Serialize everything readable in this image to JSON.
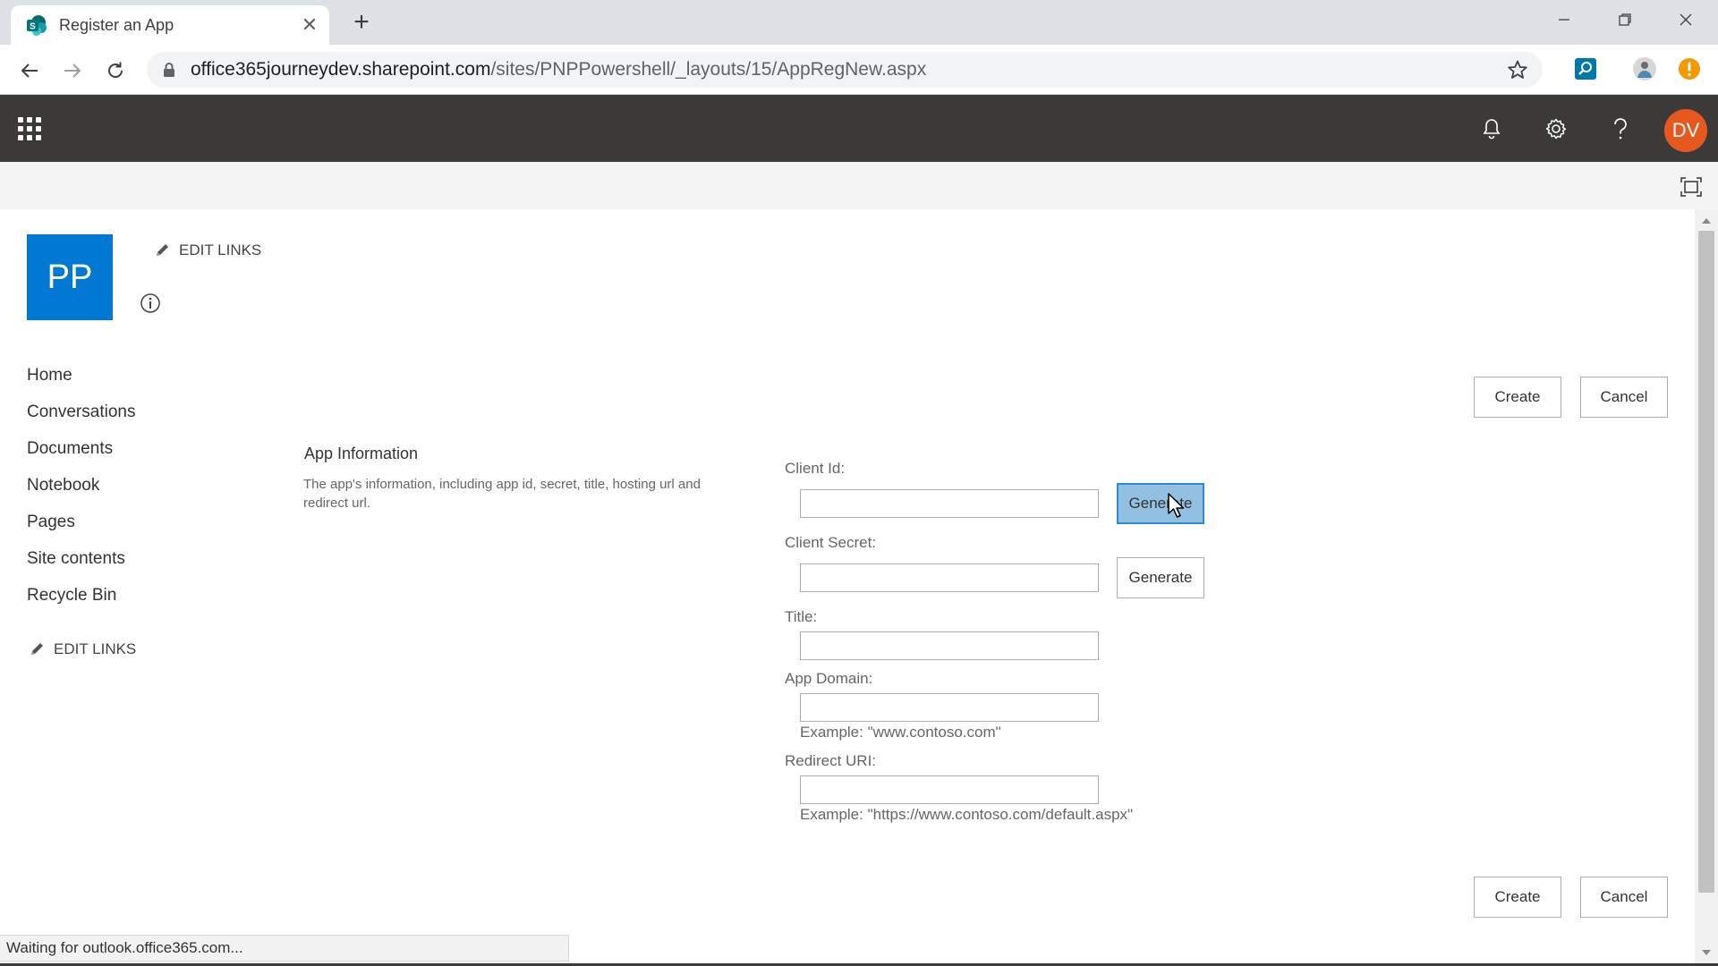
{
  "browser": {
    "tab_title": "Register an App",
    "url_host": "office365journeydev.sharepoint.com",
    "url_path": "/sites/PNPPowershell/_layouts/15/AppRegNew.aspx"
  },
  "suitebar": {
    "user_initials": "DV"
  },
  "site": {
    "logo_text": "PP",
    "edit_links_label": "EDIT LINKS"
  },
  "leftnav": {
    "items": [
      "Home",
      "Conversations",
      "Documents",
      "Notebook",
      "Pages",
      "Site contents",
      "Recycle Bin"
    ],
    "edit_links_label": "EDIT LINKS"
  },
  "form": {
    "create_label": "Create",
    "cancel_label": "Cancel",
    "section_title": "App Information",
    "section_description": "The app's information, including app id, secret, title, hosting url and redirect url.",
    "generate_label": "Generate",
    "fields": {
      "client_id": {
        "label": "Client Id:",
        "value": ""
      },
      "client_secret": {
        "label": "Client Secret:",
        "value": ""
      },
      "title": {
        "label": "Title:",
        "value": ""
      },
      "app_domain": {
        "label": "App Domain:",
        "value": "",
        "example": "Example: \"www.contoso.com\""
      },
      "redirect_uri": {
        "label": "Redirect URI:",
        "value": "",
        "example": "Example: \"https://www.contoso.com/default.aspx\""
      }
    }
  },
  "status": {
    "text": "Waiting for outlook.office365.com..."
  },
  "colors": {
    "suitebar": "#3b3a39",
    "logo": "#0078d4",
    "avatar": "#e7581f",
    "generate_active": "#92c0e0"
  }
}
